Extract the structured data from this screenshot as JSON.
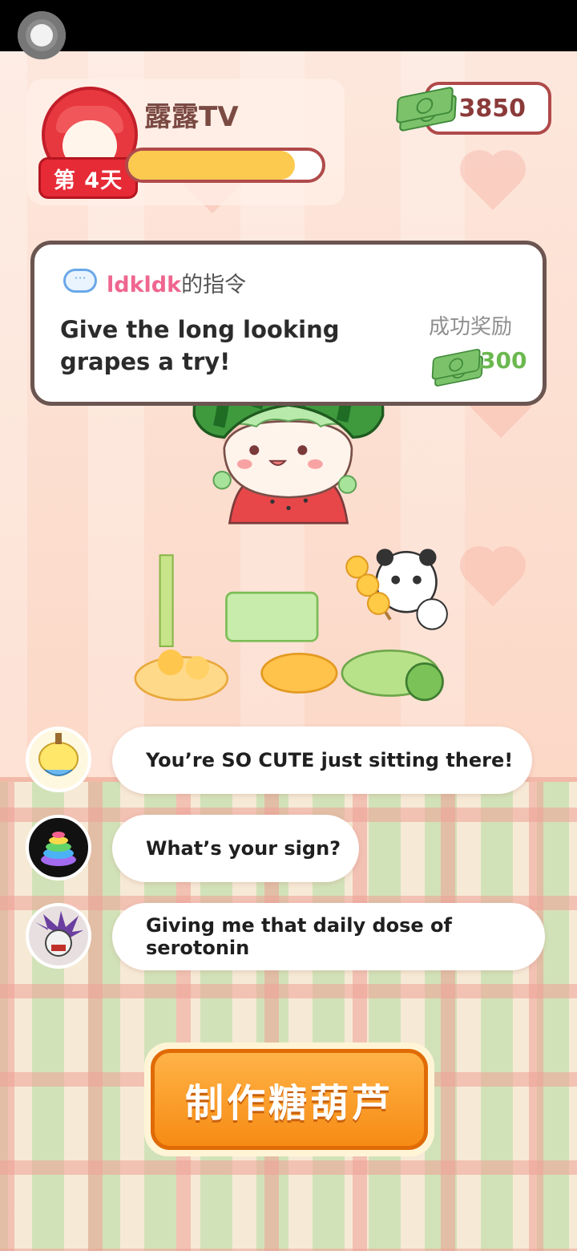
{
  "header": {
    "streamer_name": "露露TV",
    "day_label": "第 4天",
    "progress_fraction": 0.86,
    "money": "3850"
  },
  "task": {
    "from_user": "ldkldk",
    "from_suffix": "的指令",
    "instruction": "Give the long looking grapes a try!",
    "reward_label": "成功奖励",
    "reward_amount": "300"
  },
  "comments": [
    {
      "text": "You’re SO CUTE just sitting there!",
      "avatar_icon": "banana-duck-icon"
    },
    {
      "text": "What’s your sign?",
      "avatar_icon": "rainbow-swirl-icon"
    },
    {
      "text": "Giving me that daily dose of serotonin",
      "avatar_icon": "monster-icon"
    }
  ],
  "actions": {
    "make_button_label": "制作糖葫芦"
  },
  "colors": {
    "day_badge": "#e62a36",
    "progress": "#fbca4f",
    "make_button": "#f68b14",
    "reward": "#6bb84f",
    "username": "#ef6690"
  }
}
